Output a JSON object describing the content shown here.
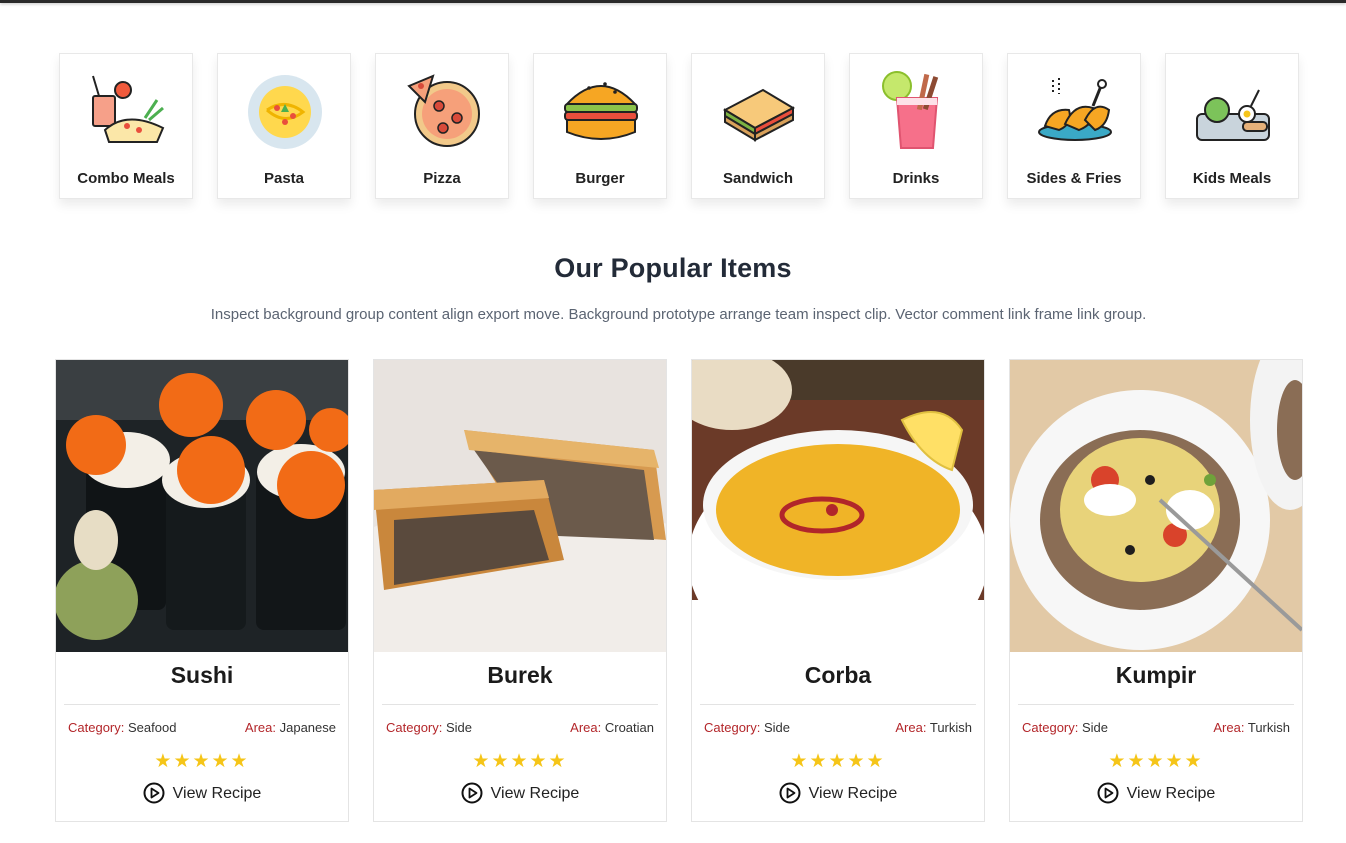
{
  "categories": [
    {
      "label": "Combo Meals",
      "icon": "combo-meals-icon"
    },
    {
      "label": "Pasta",
      "icon": "pasta-icon"
    },
    {
      "label": "Pizza",
      "icon": "pizza-icon"
    },
    {
      "label": "Burger",
      "icon": "burger-icon"
    },
    {
      "label": "Sandwich",
      "icon": "sandwich-icon"
    },
    {
      "label": "Drinks",
      "icon": "drinks-icon"
    },
    {
      "label": "Sides & Fries",
      "icon": "sides-fries-icon"
    },
    {
      "label": "Kids Meals",
      "icon": "kids-meals-icon"
    }
  ],
  "popular": {
    "title": "Our Popular Items",
    "subtitle": "Inspect background group content align export move. Background prototype arrange team inspect clip. Vector comment link frame link group."
  },
  "labels": {
    "category": "Category:",
    "area": "Area:",
    "view_recipe": "View Recipe",
    "stars": "★★★★★"
  },
  "items": [
    {
      "name": "Sushi",
      "category": "Seafood",
      "area": "Japanese",
      "rating": 5
    },
    {
      "name": "Burek",
      "category": "Side",
      "area": "Croatian",
      "rating": 5
    },
    {
      "name": "Corba",
      "category": "Side",
      "area": "Turkish",
      "rating": 5
    },
    {
      "name": "Kumpir",
      "category": "Side",
      "area": "Turkish",
      "rating": 5
    }
  ],
  "colors": {
    "accent_red": "#b3262a",
    "star_yellow": "#f5c518",
    "heading": "#232b38"
  }
}
